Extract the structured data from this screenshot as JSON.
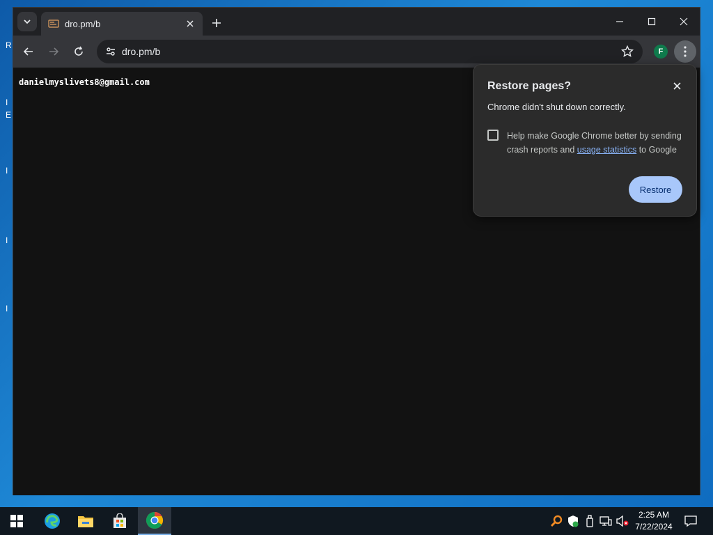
{
  "browser": {
    "tab": {
      "title": "dro.pm/b"
    },
    "address_bar": {
      "url": "dro.pm/b"
    },
    "profile_initial": "F"
  },
  "page": {
    "text": "danielmyslivets8@gmail.com"
  },
  "dialog": {
    "title": "Restore pages?",
    "message": "Chrome didn't shut down correctly.",
    "checkbox_text_before": "Help make Google Chrome better by sending crash reports and ",
    "checkbox_link": "usage statistics",
    "checkbox_text_after": " to Google",
    "checkbox_checked": false,
    "restore_label": "Restore"
  },
  "taskbar": {
    "apps": [
      "start-icon",
      "edge-icon",
      "file-explorer-icon",
      "store-icon",
      "chrome-icon"
    ],
    "active_app": "chrome-icon",
    "clock_time": "2:25 AM",
    "clock_date": "7/22/2024"
  },
  "colors": {
    "dialog_bg": "#2b2b2b",
    "restore_button": "#a8c7fa",
    "link": "#8ab4f8",
    "profile_avatar": "#0f7a4c"
  }
}
